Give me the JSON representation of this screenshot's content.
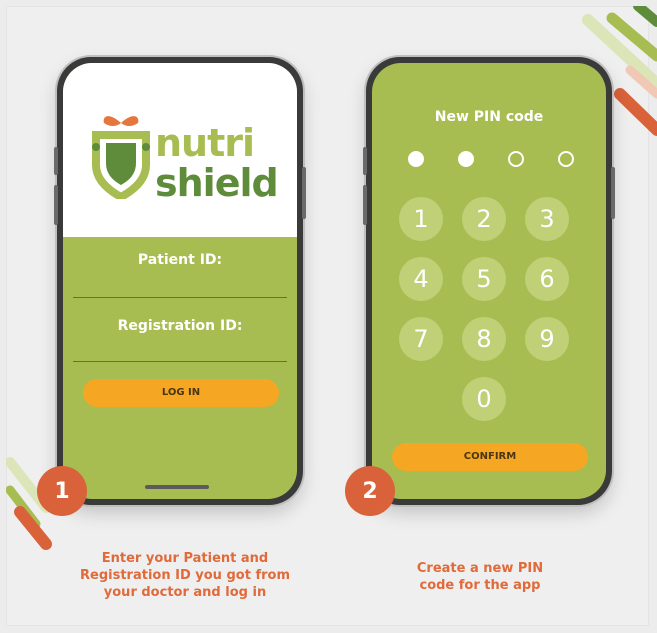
{
  "brand": {
    "word1": "nutri",
    "word2": "shield",
    "colors": {
      "green": "#a7bd52",
      "dark_green": "#5e8c3b",
      "orange": "#f5a623",
      "accent": "#d9623a"
    }
  },
  "login": {
    "patient_id_label": "Patient ID:",
    "registration_id_label": "Registration ID:",
    "login_button": "LOG IN"
  },
  "pin": {
    "title": "New PIN code",
    "filled_dots": 2,
    "total_dots": 4,
    "keys": [
      "1",
      "2",
      "3",
      "4",
      "5",
      "6",
      "7",
      "8",
      "9",
      "0"
    ],
    "confirm_button": "CONFIRM"
  },
  "steps": [
    {
      "number": "1",
      "caption_lines": [
        "Enter your Patient and",
        "Registration ID you got from",
        "your doctor and log in"
      ]
    },
    {
      "number": "2",
      "caption_lines": [
        "Create a new PIN",
        "code for the app"
      ]
    }
  ]
}
